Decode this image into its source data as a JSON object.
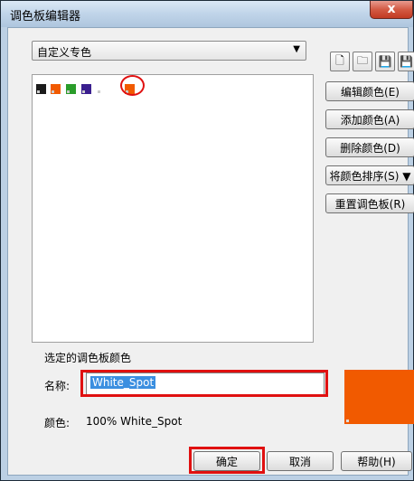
{
  "window": {
    "title": "调色板编辑器",
    "close_label": "x"
  },
  "palette_select": {
    "value": "自定义专色"
  },
  "toolbar": {
    "icons": [
      "new-palette-icon",
      "open-folder-icon",
      "save-icon",
      "save-as-icon"
    ]
  },
  "swatches": [
    {
      "color": "#1b1b1b"
    },
    {
      "color": "#f15a00"
    },
    {
      "color": "#2a9d2a"
    },
    {
      "color": "#3a1f8f"
    },
    {
      "color": "#ffffff"
    },
    {
      "color": "#f15a00"
    }
  ],
  "side_buttons": [
    {
      "label": "编辑颜色(E)"
    },
    {
      "label": "添加颜色(A)"
    },
    {
      "label": "删除颜色(D)"
    },
    {
      "label": "将颜色排序(S) ▼"
    },
    {
      "label": "重置调色板(R)"
    }
  ],
  "selected": {
    "section_title": "选定的调色板颜色",
    "name_label": "名称:",
    "name_value": "White_Spot",
    "color_label": "颜色:",
    "color_value": "100%  White_Spot",
    "color_hex": "#f15a00"
  },
  "footer": {
    "ok": "确定",
    "cancel": "取消",
    "help": "帮助(H)"
  }
}
